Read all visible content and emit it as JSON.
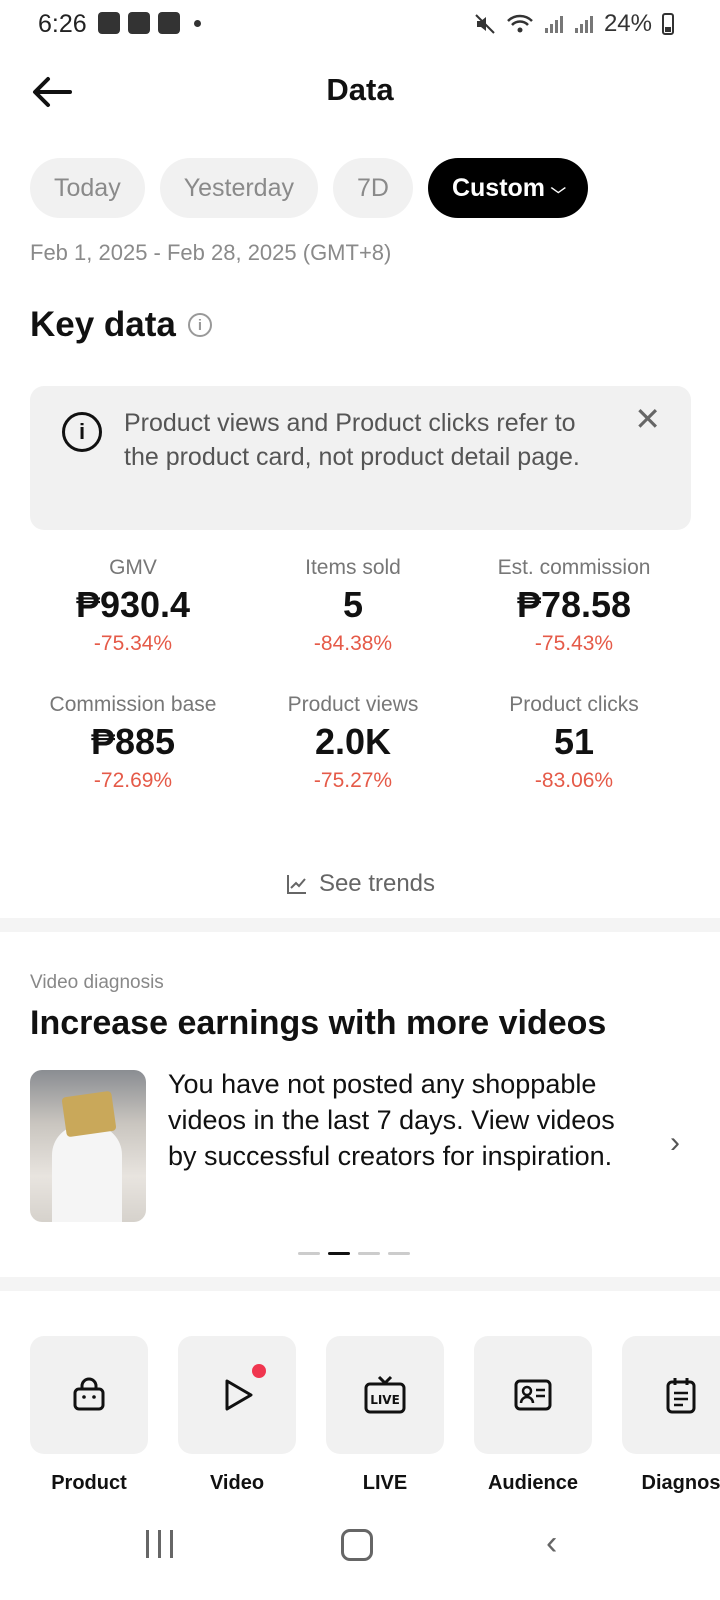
{
  "status_bar": {
    "time": "6:26",
    "battery": "24%"
  },
  "header": {
    "title": "Data",
    "back_icon": "arrow-left-icon"
  },
  "date_filters": {
    "chips": [
      {
        "label": "Today",
        "active": false
      },
      {
        "label": "Yesterday",
        "active": false
      },
      {
        "label": "7D",
        "active": false
      },
      {
        "label": "Custom",
        "active": true
      }
    ],
    "range": "Feb 1, 2025 - Feb 28, 2025 (GMT+8)"
  },
  "key_data": {
    "title": "Key data",
    "notice": "Product views and Product clicks refer to the product card, not product detail page.",
    "metrics": [
      {
        "label": "GMV",
        "value": "₱930.4",
        "change": "-75.34%"
      },
      {
        "label": "Items sold",
        "value": "5",
        "change": "-84.38%"
      },
      {
        "label": "Est. commission",
        "value": "₱78.58",
        "change": "-75.43%"
      },
      {
        "label": "Commission base",
        "value": "₱885",
        "change": "-72.69%"
      },
      {
        "label": "Product views",
        "value": "2.0K",
        "change": "-75.27%"
      },
      {
        "label": "Product clicks",
        "value": "51",
        "change": "-83.06%"
      }
    ],
    "see_trends": "See trends"
  },
  "video_diagnosis": {
    "label": "Video diagnosis",
    "title": "Increase earnings with more videos",
    "body": "You have not posted any shoppable videos in the last 7 days. View videos by successful creators for inspiration.",
    "carousel_index": 2,
    "carousel_count": 4
  },
  "tiles": [
    {
      "label": "Product",
      "icon": "shopping-bag-icon"
    },
    {
      "label": "Video",
      "icon": "play-icon",
      "badge": true
    },
    {
      "label": "LIVE",
      "icon": "live-tv-icon"
    },
    {
      "label": "Audience",
      "icon": "id-card-icon"
    },
    {
      "label": "Diagnos",
      "icon": "clipboard-icon"
    }
  ],
  "colors": {
    "negative": "#e55a48",
    "active_chip": "#000000",
    "badge": "#f0364f"
  }
}
